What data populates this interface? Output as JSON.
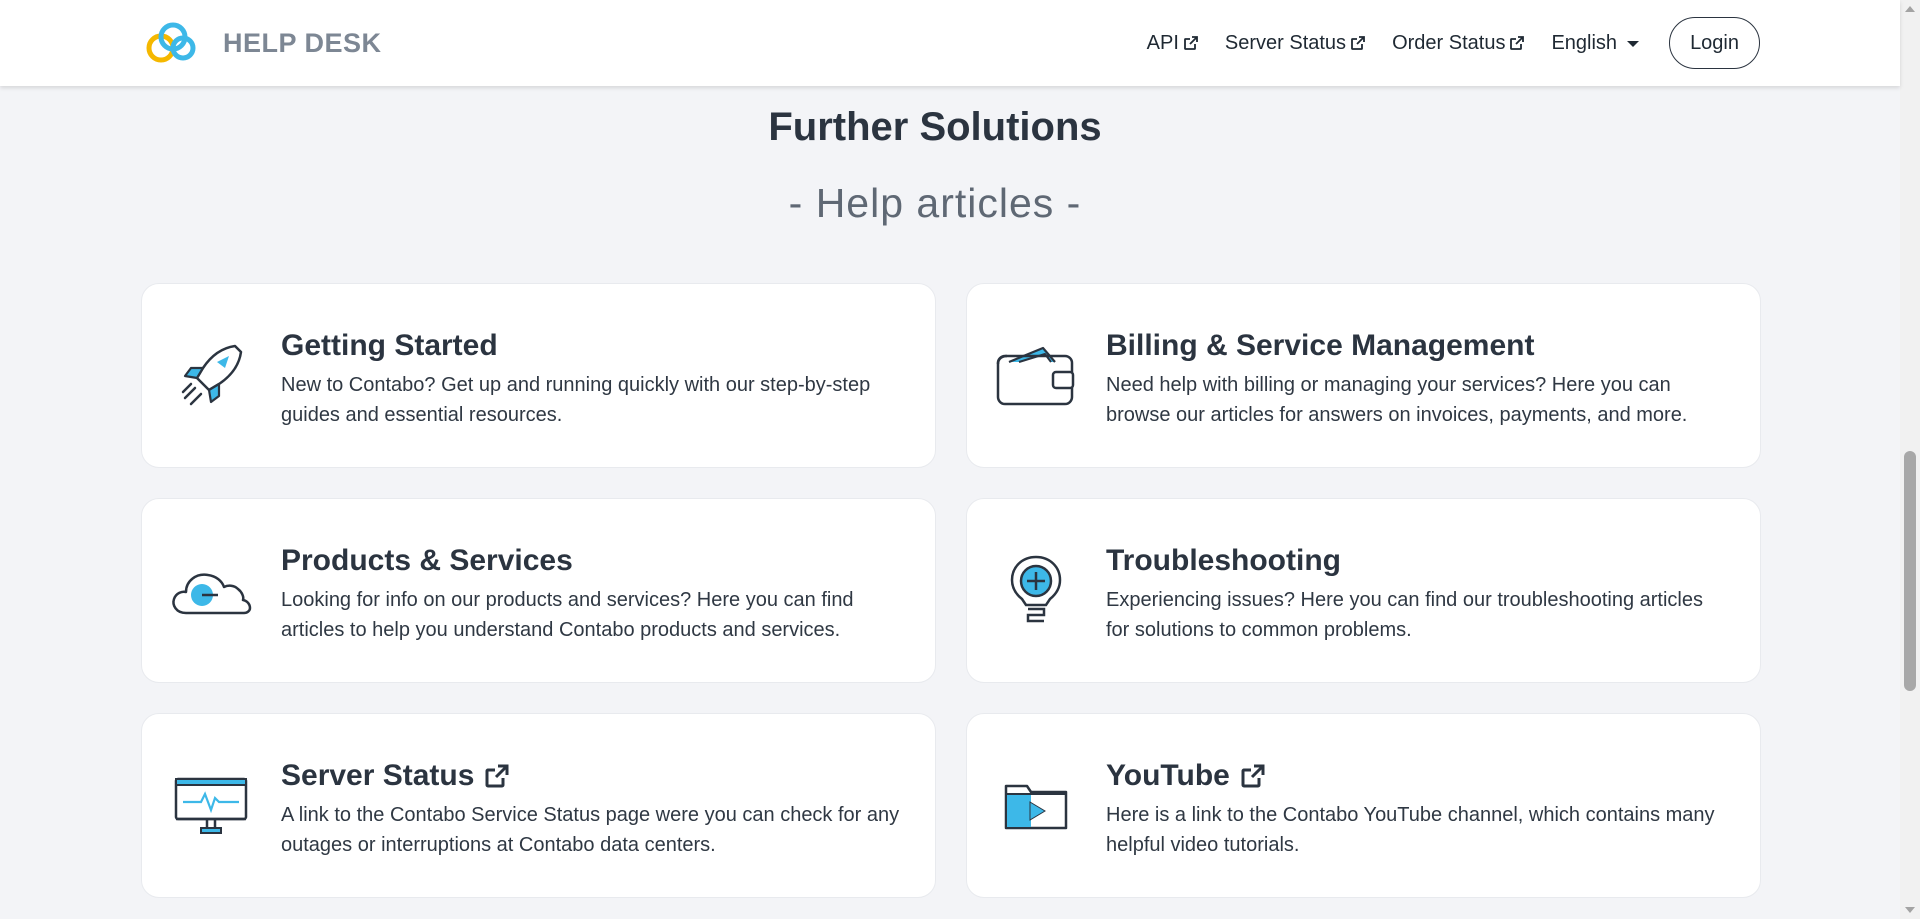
{
  "header": {
    "logo_text": "HELP DESK",
    "nav": [
      {
        "label": "API",
        "external": true
      },
      {
        "label": "Server Status",
        "external": true
      },
      {
        "label": "Order Status",
        "external": true
      }
    ],
    "language": "English",
    "login_label": "Login"
  },
  "section": {
    "title": "Further Solutions",
    "subtitle": "- Help articles -"
  },
  "cards": [
    {
      "icon": "rocket-icon",
      "title": "Getting Started",
      "description": "New to Contabo? Get up and running quickly with our step-by-step guides and essential resources.",
      "external": false
    },
    {
      "icon": "wallet-icon",
      "title": "Billing & Service Management",
      "description": "Need help with billing or managing your services? Here you can browse our articles for answers on invoices, payments, and more.",
      "external": false
    },
    {
      "icon": "cloud-icon",
      "title": "Products & Services",
      "description": "Looking for info on our products and services? Here you can find articles to help you understand Contabo products and services.",
      "external": false
    },
    {
      "icon": "lightbulb-icon",
      "title": "Troubleshooting",
      "description": "Experiencing issues? Here you can find our troubleshooting articles for solutions to common problems.",
      "external": false
    },
    {
      "icon": "monitor-pulse-icon",
      "title": "Server Status",
      "description": "A link to the Contabo Service Status page were you can check for any outages or interruptions at Contabo data centers.",
      "external": true
    },
    {
      "icon": "video-folder-icon",
      "title": "YouTube",
      "description": "Here is a link to the Contabo YouTube channel, which contains many helpful video tutorials.",
      "external": true
    }
  ],
  "colors": {
    "accent_blue": "#3db8e8",
    "accent_yellow": "#f5b800",
    "text_dark": "#2b3440",
    "page_bg": "#f3f4f7"
  }
}
